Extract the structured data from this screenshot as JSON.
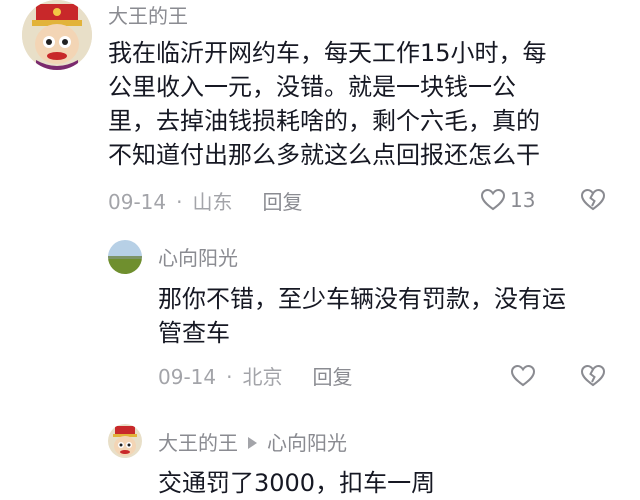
{
  "comments": [
    {
      "author": "大王的王",
      "lines": [
        "我在临沂开网约车，每天工作15小时，每",
        "公里收入一元，没错。就是一块钱一公",
        "里，去掉油钱损耗啥的，剩个六毛，真的",
        "不知道付出那么多就这么点回报还怎么干"
      ],
      "date": "09-14",
      "location": "山东",
      "reply_label": "回复",
      "like_count": "13"
    },
    {
      "author": "心向阳光",
      "lines": [
        "那你不错，至少车辆没有罚款，没有运",
        "管查车"
      ],
      "date": "09-14",
      "location": "北京",
      "reply_label": "回复"
    },
    {
      "author": "大王的王",
      "reply_to": "心向阳光",
      "lines": [
        "交通罚了3000，扣车一周"
      ]
    }
  ],
  "colors": {
    "text": "#161823",
    "name": "#8a8b91",
    "meta": "#a3a4a9",
    "icon": "#8a8b91"
  },
  "icons": [
    "avatar-king",
    "avatar-landscape",
    "heart-outline",
    "broken-heart"
  ]
}
